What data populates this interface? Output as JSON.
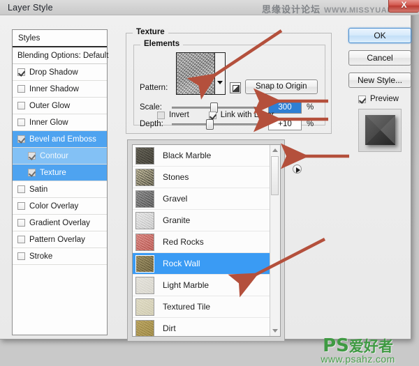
{
  "window": {
    "title": "Layer Style",
    "close_label": "X"
  },
  "watermarks": {
    "top_cn": "思缘设计论坛",
    "top_url": "WWW.MISSYUAN.COM",
    "bottom_ps": "PS",
    "bottom_cn": "爱好者",
    "bottom_url": "www.psahz.com"
  },
  "styles_panel": {
    "header": "Styles",
    "blending_options": "Blending Options: Default",
    "items": [
      {
        "label": "Drop Shadow",
        "checked": true,
        "selected": false,
        "indent": false
      },
      {
        "label": "Inner Shadow",
        "checked": false,
        "selected": false,
        "indent": false
      },
      {
        "label": "Outer Glow",
        "checked": false,
        "selected": false,
        "indent": false
      },
      {
        "label": "Inner Glow",
        "checked": false,
        "selected": false,
        "indent": false
      },
      {
        "label": "Bevel and Emboss",
        "checked": true,
        "selected": true,
        "indent": false
      },
      {
        "label": "Contour",
        "checked": true,
        "selected": "light",
        "indent": true
      },
      {
        "label": "Texture",
        "checked": true,
        "selected": true,
        "indent": true
      },
      {
        "label": "Satin",
        "checked": false,
        "selected": false,
        "indent": false
      },
      {
        "label": "Color Overlay",
        "checked": false,
        "selected": false,
        "indent": false
      },
      {
        "label": "Gradient Overlay",
        "checked": false,
        "selected": false,
        "indent": false
      },
      {
        "label": "Pattern Overlay",
        "checked": false,
        "selected": false,
        "indent": false
      },
      {
        "label": "Stroke",
        "checked": false,
        "selected": false,
        "indent": false
      }
    ]
  },
  "texture": {
    "group_title": "Texture",
    "elements_title": "Elements",
    "pattern_label": "Pattern:",
    "snap_to_origin": "Snap to Origin",
    "scale": {
      "label": "Scale:",
      "value": "300",
      "unit": "%",
      "thumb_percent": 47
    },
    "depth": {
      "label": "Depth:",
      "value": "+10",
      "unit": "%",
      "thumb_percent": 42
    },
    "invert": {
      "label": "Invert",
      "checked": false
    },
    "link_with_layer": {
      "label": "Link with Layer",
      "checked": true
    }
  },
  "pattern_list": {
    "selected": "Rock Wall",
    "items": [
      {
        "name": "Black Marble",
        "color1": "#6d6a5e",
        "color2": "#2f2d26"
      },
      {
        "name": "Stones",
        "color1": "#cfc7a8",
        "color2": "#2b2a22"
      },
      {
        "name": "Gravel",
        "color1": "#9c9c9c",
        "color2": "#3e3e3e"
      },
      {
        "name": "Granite",
        "color1": "#efefef",
        "color2": "#b5b5b5"
      },
      {
        "name": "Red Rocks",
        "color1": "#e39a95",
        "color2": "#a8423b"
      },
      {
        "name": "Rock Wall",
        "color1": "#a79a6e",
        "color2": "#554b2c"
      },
      {
        "name": "Light Marble",
        "color1": "#e9e7e0",
        "color2": "#cfcdc4"
      },
      {
        "name": "Textured Tile",
        "color1": "#e4e0cb",
        "color2": "#c8c3a8"
      },
      {
        "name": "Dirt",
        "color1": "#c3ad6b",
        "color2": "#8a7736"
      }
    ]
  },
  "buttons": {
    "ok": "OK",
    "cancel": "Cancel",
    "new_style": "New Style...",
    "preview": "Preview",
    "preview_checked": true
  },
  "annotation": {
    "color": "#b4503c",
    "count": 4
  }
}
